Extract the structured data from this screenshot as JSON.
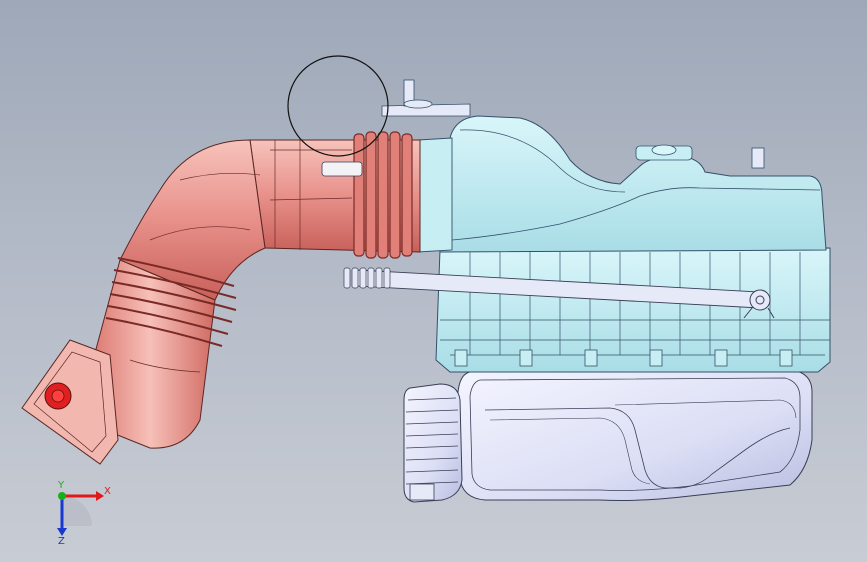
{
  "viewport": {
    "background_top": "#9ea8b8",
    "background_bottom": "#c8ccd4"
  },
  "model": {
    "parts": [
      {
        "name": "intake-duct",
        "color": "#e8958c"
      },
      {
        "name": "mounting-flange",
        "color": "#f2b8b0"
      },
      {
        "name": "flange-port",
        "color": "#e02020"
      },
      {
        "name": "air-filter-box",
        "color": "#c6eef3"
      },
      {
        "name": "lower-tray",
        "color": "#e6e9f8"
      },
      {
        "name": "outlet-pipe",
        "color": "#e6e9f8"
      },
      {
        "name": "breather-rod",
        "color": "#e6e9f8"
      }
    ],
    "selection_circle": true
  },
  "triad": {
    "x_label": "X",
    "y_label": "Y",
    "z_label": "Z",
    "x_color": "#e01818",
    "y_color": "#18b018",
    "z_color": "#1838d0"
  }
}
